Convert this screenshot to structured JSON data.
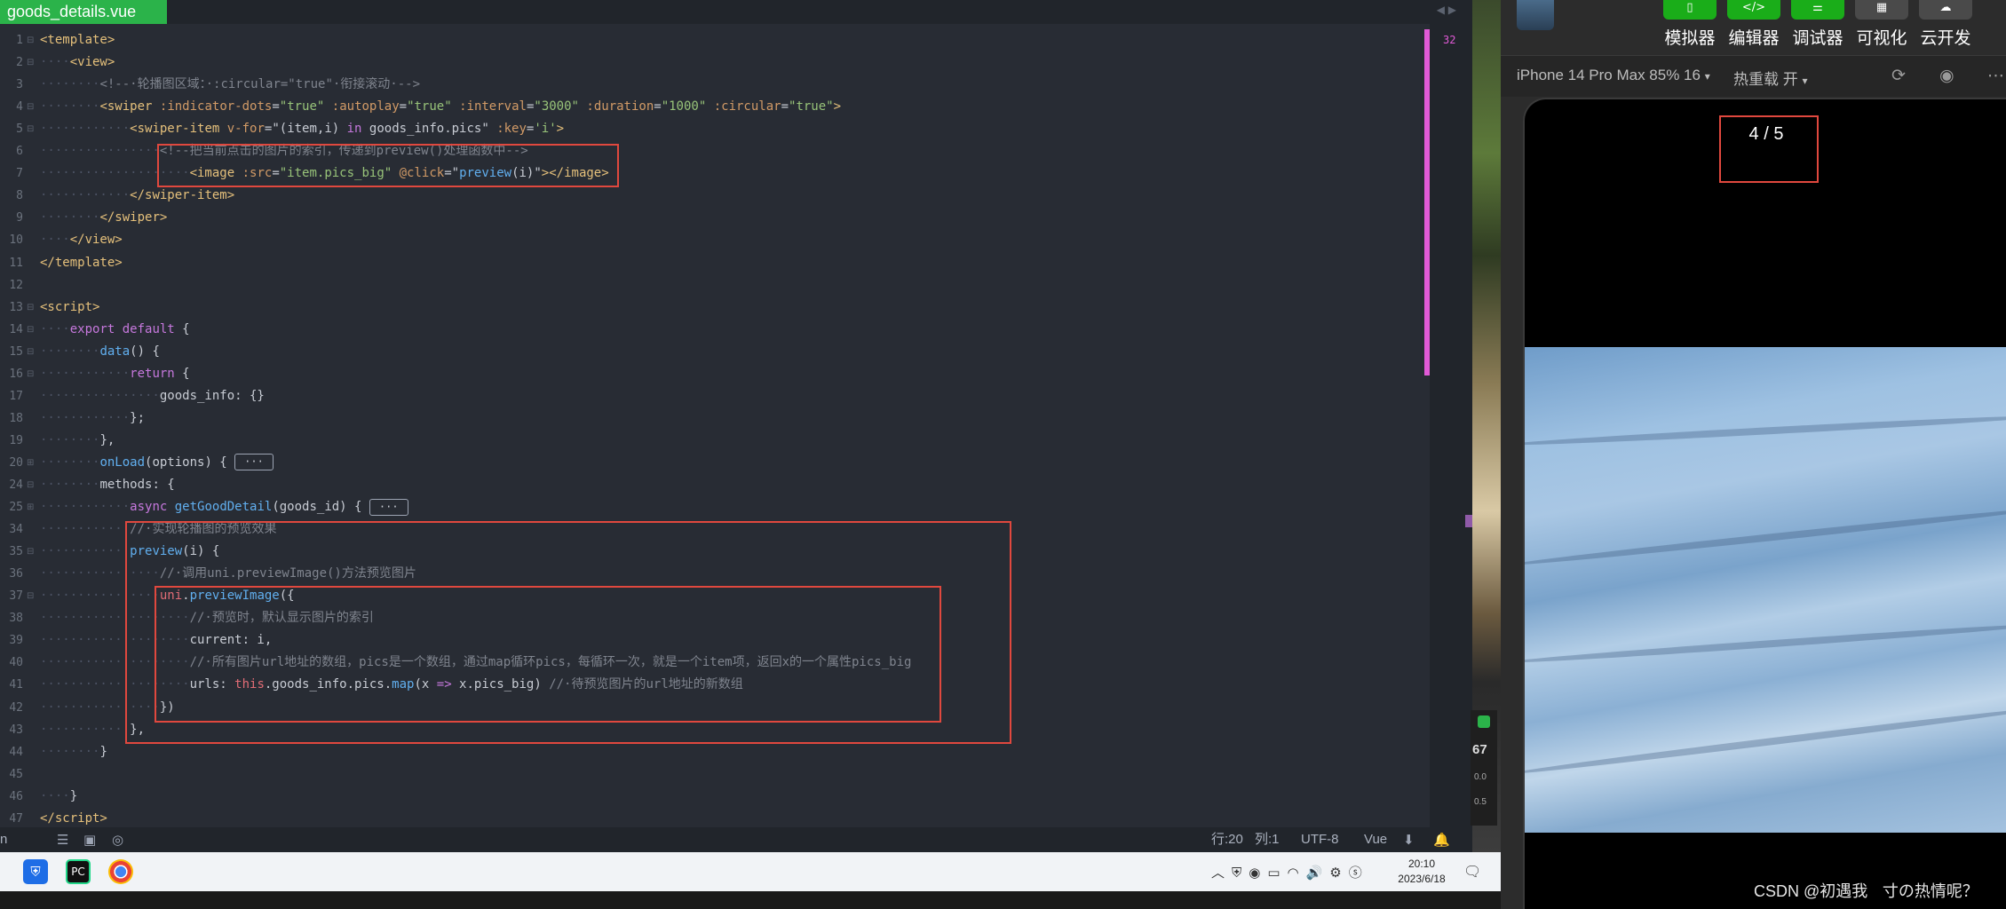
{
  "editor": {
    "tab_title": "goods_details.vue",
    "minimap_number": "32",
    "lines": [
      {
        "n": "1",
        "fold": "⊟",
        "html": "<span class='t-tag'>&lt;template&gt;</span>"
      },
      {
        "n": "2",
        "fold": "⊟",
        "html": "<span class='t-dot'>····</span><span class='t-tag'>&lt;view&gt;</span>"
      },
      {
        "n": "3",
        "fold": "",
        "html": "<span class='t-dot'>········</span><span class='t-com'>&lt;!--·轮播图区域：·:circular=\"true\"·衔接滚动·--&gt;</span>"
      },
      {
        "n": "4",
        "fold": "⊟",
        "html": "<span class='t-dot'>········</span><span class='t-tag'>&lt;swiper</span> <span class='t-attr'>:indicator-dots</span>=<span class='t-str'>\"true\"</span> <span class='t-attr'>:autoplay</span>=<span class='t-str'>\"true\"</span> <span class='t-attr'>:interval</span>=<span class='t-str'>\"3000\"</span> <span class='t-attr'>:duration</span>=<span class='t-str'>\"1000\"</span> <span class='t-attr'>:circular</span>=<span class='t-str'>\"true\"</span><span class='t-tag'>&gt;</span>"
      },
      {
        "n": "5",
        "fold": "⊟",
        "html": "<span class='t-dot'>············</span><span class='t-tag'>&lt;swiper-item</span> <span class='t-attr'>v-for</span>=\"(item,i) <span class='t-kw'>in</span> goods_info.pics\" <span class='t-attr'>:key</span>=<span class='t-str'>'i'</span><span class='t-tag'>&gt;</span>"
      },
      {
        "n": "6",
        "fold": "",
        "html": "<span class='t-dot'>················</span><span class='t-com'>&lt;!--把当前点击的图片的索引，传递到preview()处理函数中--&gt;</span>"
      },
      {
        "n": "7",
        "fold": "",
        "html": "<span class='t-dot'>····················</span><span class='t-tag'>&lt;image</span> <span class='t-attr'>:src</span>=<span class='t-str'>\"item.pics_big\"</span> <span class='t-attr'>@click</span>=\"<span class='t-fn'>preview</span>(i)\"<span class='t-tag'>&gt;&lt;/image&gt;</span>"
      },
      {
        "n": "8",
        "fold": "",
        "html": "<span class='t-dot'>············</span><span class='t-tag'>&lt;/swiper-item&gt;</span>"
      },
      {
        "n": "9",
        "fold": "",
        "html": "<span class='t-dot'>········</span><span class='t-tag'>&lt;/swiper&gt;</span>"
      },
      {
        "n": "10",
        "fold": "",
        "html": "<span class='t-dot'>····</span><span class='t-tag'>&lt;/view&gt;</span>"
      },
      {
        "n": "11",
        "fold": "",
        "html": "<span class='t-tag'>&lt;/template&gt;</span>"
      },
      {
        "n": "12",
        "fold": "",
        "html": ""
      },
      {
        "n": "13",
        "fold": "⊟",
        "html": "<span class='t-tag'>&lt;script&gt;</span>"
      },
      {
        "n": "14",
        "fold": "⊟",
        "html": "<span class='t-dot'>····</span><span class='t-kw'>export</span> <span class='t-kw'>default</span> {"
      },
      {
        "n": "15",
        "fold": "⊟",
        "html": "<span class='t-dot'>········</span><span class='t-fn'>data</span>() {"
      },
      {
        "n": "16",
        "fold": "⊟",
        "html": "<span class='t-dot'>············</span><span class='t-kw'>return</span> {"
      },
      {
        "n": "17",
        "fold": "",
        "html": "<span class='t-dot'>················</span>goods_info: {}"
      },
      {
        "n": "18",
        "fold": "",
        "html": "<span class='t-dot'>············</span>};"
      },
      {
        "n": "19",
        "fold": "",
        "html": "<span class='t-dot'>········</span>},"
      },
      {
        "n": "20",
        "fold": "⊞",
        "html": "<span class='t-dot'>········</span><span class='t-fn'>onLoad</span>(options) { <span class='fold-box'>···</span>"
      },
      {
        "n": "24",
        "fold": "⊟",
        "html": "<span class='t-dot'>········</span>methods: {"
      },
      {
        "n": "25",
        "fold": "⊞",
        "html": "<span class='t-dot'>············</span><span class='t-kw'>async</span> <span class='t-fn'>getGoodDetail</span>(goods_id) { <span class='fold-box'>···</span>"
      },
      {
        "n": "34",
        "fold": "",
        "html": "<span class='t-dot'>············</span><span class='t-com'>//·实现轮播图的预览效果</span>"
      },
      {
        "n": "35",
        "fold": "⊟",
        "html": "<span class='t-dot'>············</span><span class='t-fn'>preview</span>(i) {"
      },
      {
        "n": "36",
        "fold": "",
        "html": "<span class='t-dot'>················</span><span class='t-com'>//·调用uni.previewImage()方法预览图片</span>"
      },
      {
        "n": "37",
        "fold": "⊟",
        "html": "<span class='t-dot'>················</span><span class='t-this'>uni</span>.<span class='t-fn'>previewImage</span>({"
      },
      {
        "n": "38",
        "fold": "",
        "html": "<span class='t-dot'>····················</span><span class='t-com'>//·预览时，默认显示图片的索引</span>"
      },
      {
        "n": "39",
        "fold": "",
        "html": "<span class='t-dot'>····················</span>current: i,"
      },
      {
        "n": "40",
        "fold": "",
        "html": "<span class='t-dot'>····················</span><span class='t-com'>//·所有图片url地址的数组，pics是一个数组，通过map循环pics，每循环一次，就是一个item项，返回x的一个属性pics_big</span>"
      },
      {
        "n": "41",
        "fold": "",
        "html": "<span class='t-dot'>····················</span>urls: <span class='t-this'>this</span>.goods_info.pics.<span class='t-fn'>map</span>(x <span class='t-kw'>=&gt;</span> x.pics_big) <span class='t-com'>//·待预览图片的url地址的新数组</span>"
      },
      {
        "n": "42",
        "fold": "",
        "html": "<span class='t-dot'>················</span>})"
      },
      {
        "n": "43",
        "fold": "",
        "html": "<span class='t-dot'>············</span>},"
      },
      {
        "n": "44",
        "fold": "",
        "html": "<span class='t-dot'>········</span>}"
      },
      {
        "n": "45",
        "fold": "",
        "html": ""
      },
      {
        "n": "46",
        "fold": "",
        "html": "<span class='t-dot'>····</span>}"
      },
      {
        "n": "47",
        "fold": "",
        "html": "<span class='t-tag'>&lt;/script&gt;</span>"
      }
    ]
  },
  "statusbar": {
    "left_char": "n",
    "row": "行:20",
    "col": "列:1",
    "encoding": "UTF-8",
    "language": "Vue"
  },
  "taskbar": {
    "time": "20:10",
    "date": "2023/6/18"
  },
  "net": {
    "percent": "67",
    "down": "0.0",
    "up": "0.5"
  },
  "simulator": {
    "tools": [
      "模拟器",
      "编辑器",
      "调试器",
      "可视化",
      "云开发"
    ],
    "device": "iPhone 14 Pro Max 85% 16",
    "hot_reload": "热重载 开",
    "counter": "4 / 5"
  },
  "watermark": "CSDN @初遇我ㅤ寸の热情呢？"
}
